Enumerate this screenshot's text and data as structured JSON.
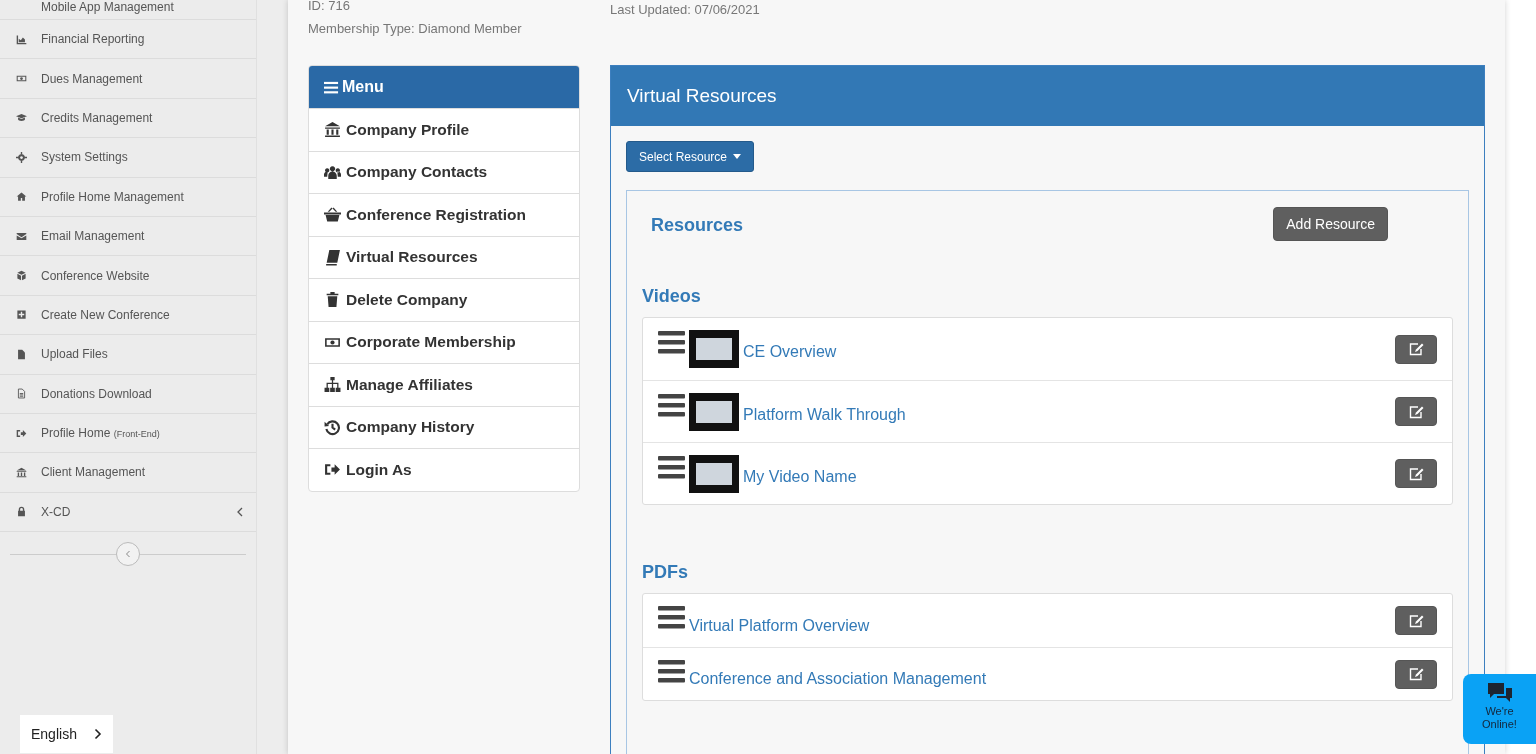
{
  "sidebar": {
    "items": [
      {
        "label": "Mobile App Management",
        "kind": "link"
      },
      {
        "label": "Financial Reporting",
        "kind": "link"
      },
      {
        "label": "Dues Management",
        "kind": "link"
      },
      {
        "label": "Credits Management",
        "kind": "link"
      },
      {
        "label": "System Settings",
        "kind": "link"
      },
      {
        "label": "Profile Home Management",
        "kind": "link"
      },
      {
        "label": "Email Management",
        "kind": "link"
      },
      {
        "label": "Conference Website",
        "kind": "link"
      },
      {
        "label": "Create New Conference",
        "kind": "link"
      },
      {
        "label": "Upload Files",
        "kind": "link"
      },
      {
        "label": "Donations Download",
        "kind": "link"
      },
      {
        "label": "Profile Home",
        "suffix": "(Front-End)",
        "kind": "link"
      },
      {
        "label": "Client Management",
        "kind": "link"
      },
      {
        "label": "X-CD",
        "kind": "submenu"
      }
    ],
    "language": "English"
  },
  "company": {
    "id": "ID: 716",
    "membership": "Membership Type: Diamond Member",
    "last_updated": "Last Updated: 07/06/2021"
  },
  "menu": {
    "title": "Menu",
    "items": [
      "Company Profile",
      "Company Contacts",
      "Conference Registration",
      "Virtual Resources",
      "Delete Company",
      "Corporate Membership",
      "Manage Affiliates",
      "Company History",
      "Login As"
    ]
  },
  "panel": {
    "title": "Virtual Resources",
    "select_button": "Select Resource",
    "resources_title": "Resources",
    "add_button": "Add Resource",
    "sections": [
      {
        "title": "Videos",
        "kind": "video",
        "items": [
          "CE Overview",
          "Platform Walk Through",
          "My Video Name"
        ]
      },
      {
        "title": "PDFs",
        "kind": "pdf",
        "items": [
          "Virtual Platform Overview",
          "Conference and Association Management"
        ]
      }
    ]
  },
  "chat": {
    "text": "We're Online!"
  }
}
